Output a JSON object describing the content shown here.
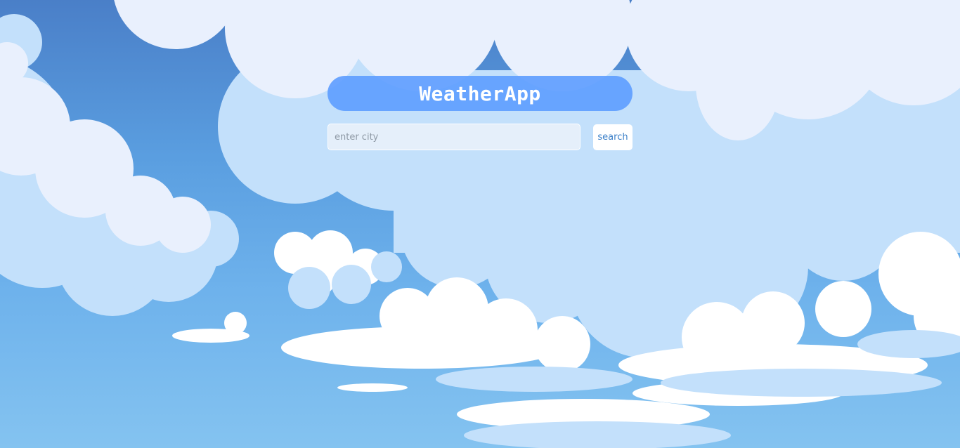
{
  "app": {
    "title": "WeatherApp"
  },
  "search": {
    "placeholder": "enter city",
    "value": "",
    "button_label": "search"
  },
  "colors": {
    "sky_top": "#4a7fc8",
    "sky_bottom": "#84c3f0",
    "cloud_light": "#c3e0fb",
    "cloud_pale": "#e9f0fd",
    "cloud_white": "#ffffff",
    "title_bar": "#609eff",
    "button_text": "#3a7fc8"
  },
  "background": {
    "icon": "cartoon-cloud-sky"
  }
}
